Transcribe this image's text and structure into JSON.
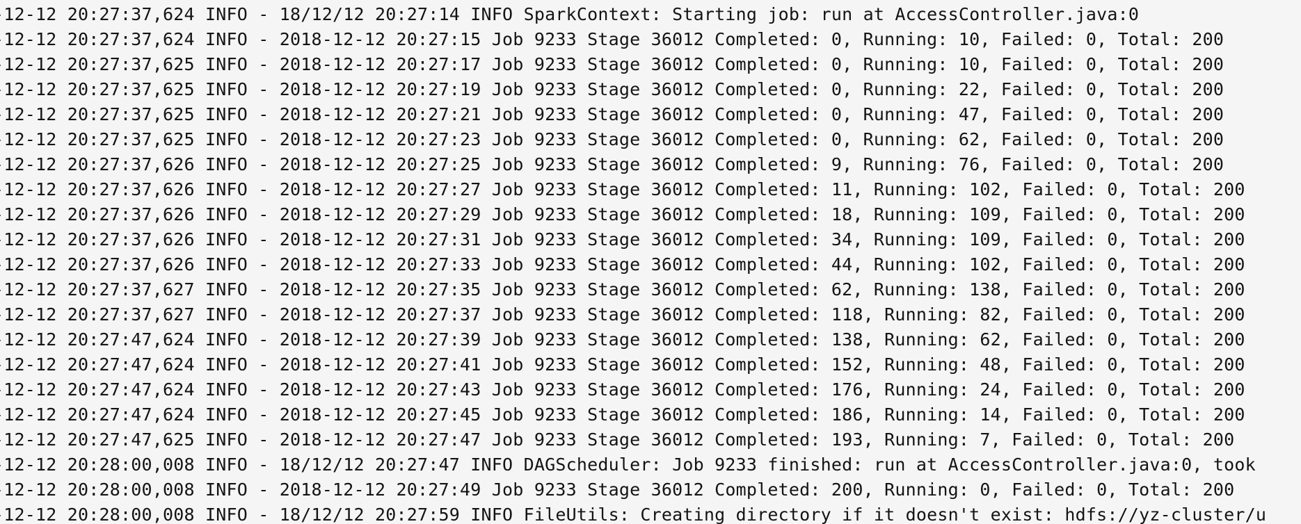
{
  "log": {
    "lines": [
      "-12-12 20:27:37,624 INFO - 18/12/12 20:27:14 INFO SparkContext: Starting job: run at AccessController.java:0",
      "-12-12 20:27:37,624 INFO - 2018-12-12 20:27:15 Job 9233 Stage 36012 Completed: 0, Running: 10, Failed: 0, Total: 200",
      "-12-12 20:27:37,625 INFO - 2018-12-12 20:27:17 Job 9233 Stage 36012 Completed: 0, Running: 10, Failed: 0, Total: 200",
      "-12-12 20:27:37,625 INFO - 2018-12-12 20:27:19 Job 9233 Stage 36012 Completed: 0, Running: 22, Failed: 0, Total: 200",
      "-12-12 20:27:37,625 INFO - 2018-12-12 20:27:21 Job 9233 Stage 36012 Completed: 0, Running: 47, Failed: 0, Total: 200",
      "-12-12 20:27:37,625 INFO - 2018-12-12 20:27:23 Job 9233 Stage 36012 Completed: 0, Running: 62, Failed: 0, Total: 200",
      "-12-12 20:27:37,626 INFO - 2018-12-12 20:27:25 Job 9233 Stage 36012 Completed: 9, Running: 76, Failed: 0, Total: 200",
      "-12-12 20:27:37,626 INFO - 2018-12-12 20:27:27 Job 9233 Stage 36012 Completed: 11, Running: 102, Failed: 0, Total: 200",
      "-12-12 20:27:37,626 INFO - 2018-12-12 20:27:29 Job 9233 Stage 36012 Completed: 18, Running: 109, Failed: 0, Total: 200",
      "-12-12 20:27:37,626 INFO - 2018-12-12 20:27:31 Job 9233 Stage 36012 Completed: 34, Running: 109, Failed: 0, Total: 200",
      "-12-12 20:27:37,626 INFO - 2018-12-12 20:27:33 Job 9233 Stage 36012 Completed: 44, Running: 102, Failed: 0, Total: 200",
      "-12-12 20:27:37,627 INFO - 2018-12-12 20:27:35 Job 9233 Stage 36012 Completed: 62, Running: 138, Failed: 0, Total: 200",
      "-12-12 20:27:37,627 INFO - 2018-12-12 20:27:37 Job 9233 Stage 36012 Completed: 118, Running: 82, Failed: 0, Total: 200",
      "-12-12 20:27:47,624 INFO - 2018-12-12 20:27:39 Job 9233 Stage 36012 Completed: 138, Running: 62, Failed: 0, Total: 200",
      "-12-12 20:27:47,624 INFO - 2018-12-12 20:27:41 Job 9233 Stage 36012 Completed: 152, Running: 48, Failed: 0, Total: 200",
      "-12-12 20:27:47,624 INFO - 2018-12-12 20:27:43 Job 9233 Stage 36012 Completed: 176, Running: 24, Failed: 0, Total: 200",
      "-12-12 20:27:47,624 INFO - 2018-12-12 20:27:45 Job 9233 Stage 36012 Completed: 186, Running: 14, Failed: 0, Total: 200",
      "-12-12 20:27:47,625 INFO - 2018-12-12 20:27:47 Job 9233 Stage 36012 Completed: 193, Running: 7, Failed: 0, Total: 200",
      "-12-12 20:28:00,008 INFO - 18/12/12 20:27:47 INFO DAGScheduler: Job 9233 finished: run at AccessController.java:0, took",
      "-12-12 20:28:00,008 INFO - 2018-12-12 20:27:49 Job 9233 Stage 36012 Completed: 200, Running: 0, Failed: 0, Total: 200",
      "-12-12 20:28:00,008 INFO - 18/12/12 20:27:59 INFO FileUtils: Creating directory if it doesn't exist: hdfs://yz-cluster/u"
    ]
  }
}
